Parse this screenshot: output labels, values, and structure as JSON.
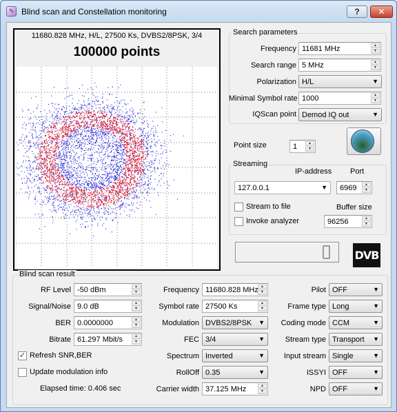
{
  "window": {
    "title": "Blind scan and Constellation monitoring",
    "help_label": "?",
    "close_label": "✕"
  },
  "constellation": {
    "info": "11680.828 MHz, H/L, 27500 Ks, DVBS2/8PSK, 3/4",
    "points_label": "100000 points"
  },
  "search": {
    "group_title": "Search parameters",
    "frequency_label": "Frequency",
    "frequency_value": "11681 MHz",
    "search_range_label": "Search range",
    "search_range_value": "5 MHz",
    "polarization_label": "Polarization",
    "polarization_value": "H/L",
    "min_symbol_rate_label": "Minimal Symbol rate",
    "min_symbol_rate_value": "1000",
    "iqscan_label": "IQScan point",
    "iqscan_value": "Demod IQ out"
  },
  "point_size": {
    "label": "Point size",
    "value": "1"
  },
  "streaming": {
    "group_title": "Streaming",
    "ip_label": "IP-address",
    "port_label": "Port",
    "ip_value": "127.0.0.1",
    "port_value": "6969",
    "stream_to_file_label": "Stream to file",
    "stream_to_file_checked": false,
    "invoke_analyzer_label": "Invoke analyzer",
    "invoke_analyzer_checked": false,
    "buffer_size_label": "Buffer size",
    "buffer_size_value": "96256"
  },
  "lcd": {
    "value": "0"
  },
  "dvb_logo": "DVB",
  "result": {
    "group_title": "Blind scan result",
    "rf_level_label": "RF Level",
    "rf_level_value": "-50 dBm",
    "snr_label": "Signal/Noise",
    "snr_value": "9.0 dB",
    "ber_label": "BER",
    "ber_value": "0.0000000",
    "bitrate_label": "Bitrate",
    "bitrate_value": "61.297 Mbit/s",
    "refresh_label": "Refresh SNR,BER",
    "refresh_checked": true,
    "update_mod_label": "Update modulation info",
    "update_mod_checked": false,
    "elapsed_label": "Elapsed time: 0.406 sec",
    "frequency_label": "Frequency",
    "frequency_value": "11680.828 MHz",
    "symbol_rate_label": "Symbol rate",
    "symbol_rate_value": "27500 Ks",
    "modulation_label": "Modulation",
    "modulation_value": "DVBS2/8PSK",
    "fec_label": "FEC",
    "fec_value": "3/4",
    "spectrum_label": "Spectrum",
    "spectrum_value": "Inverted",
    "rolloff_label": "RollOff",
    "rolloff_value": "0.35",
    "carrier_width_label": "Carrier width",
    "carrier_width_value": "37.125 MHz",
    "pilot_label": "Pilot",
    "pilot_value": "OFF",
    "frame_type_label": "Frame type",
    "frame_type_value": "Long",
    "coding_mode_label": "Coding mode",
    "coding_mode_value": "CCM",
    "stream_type_label": "Stream type",
    "stream_type_value": "Transport",
    "input_stream_label": "Input stream",
    "input_stream_value": "Single",
    "issyi_label": "ISSYI",
    "issyi_value": "OFF",
    "npd_label": "NPD",
    "npd_value": "OFF"
  },
  "colors": {
    "scatter_inner": "#e01020",
    "scatter_outer": "#1a1ad8",
    "titlebar": "#c6daf0"
  }
}
